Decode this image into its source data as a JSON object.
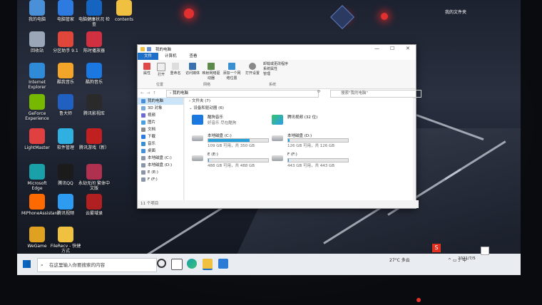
{
  "desktop_icons": [
    {
      "label": "我的电脑",
      "color": "#4a90d9"
    },
    {
      "label": "电脑管家",
      "color": "#2d7be0"
    },
    {
      "label": "电脑健康状况\n检查",
      "color": "#1565c0"
    },
    {
      "label": "contents",
      "color": "#f0c040"
    },
    {
      "label": "回收站",
      "color": "#9aa7b8"
    },
    {
      "label": "分区助手 9.1",
      "color": "#e0463a"
    },
    {
      "label": "陈时播放器",
      "color": "#d03040"
    },
    {
      "label": "Internet Explorer",
      "color": "#2f8ad8"
    },
    {
      "label": "酷我音乐",
      "color": "#f3a52a"
    },
    {
      "label": "酷狗音乐",
      "color": "#1b78e0"
    },
    {
      "label": "GeForce Experience",
      "color": "#76b900"
    },
    {
      "label": "鲁大师",
      "color": "#2060c0"
    },
    {
      "label": "腾讯影视库",
      "color": "#2a2a2a"
    },
    {
      "label": "LightMaster",
      "color": "#e04040"
    },
    {
      "label": "软件管理",
      "color": "#30b0e0"
    },
    {
      "label": "腾讯游戏（新）",
      "color": "#c02020"
    },
    {
      "label": "Microsoft Edge",
      "color": "#1aa0a8"
    },
    {
      "label": "腾讯QQ",
      "color": "#1b1b1b"
    },
    {
      "label": "永劫无间 繁体中文版",
      "color": "#b03050"
    },
    {
      "label": "MiPhoneAssistant",
      "color": "#ff6a00"
    },
    {
      "label": "腾讯视频",
      "color": "#2d9cf0"
    },
    {
      "label": "云雾域录",
      "color": "#b02020"
    },
    {
      "label": "WeGame",
      "color": "#e0a020"
    },
    {
      "label": "FileRecv - 快捷方式",
      "color": "#f0c040"
    }
  ],
  "top_right_label": "我的文件夹",
  "explorer": {
    "title": "我的电脑",
    "tabs": [
      "文件",
      "计算机",
      "查看"
    ],
    "ribbon": {
      "buttons": [
        "属性",
        "打开",
        "重命名",
        "访问媒体",
        "映射网络驱动器",
        "添加一个网络位置",
        "打开设置"
      ],
      "side_items": [
        "卸载或更改程序",
        "系统属性",
        "管理"
      ],
      "groups": [
        "位置",
        "网络",
        "系统"
      ]
    },
    "address": "我的电脑",
    "search_placeholder": "搜索\"我的电脑\"",
    "nav_items": [
      "我的电脑",
      "3D 对象",
      "视频",
      "图片",
      "文档",
      "下载",
      "音乐",
      "桌面",
      "本地磁盘 (C:)",
      "本地磁盘 (D:)",
      "E (E:)",
      "F (F:)"
    ],
    "section_folders": "文件夹 (7)",
    "section_devices": "设备和驱动器 (6)",
    "apps": [
      {
        "name": "酷狗音乐",
        "sub": "好音乐 尽在酷狗",
        "color": "#1b78e0"
      },
      {
        "name": "腾讯视频 (32 位)",
        "sub": "",
        "color": "#2d9cf0"
      }
    ],
    "drives": [
      {
        "name": "本地磁盘 (C:)",
        "space": "109 GB 可用，共 350 GB",
        "used": 0.69
      },
      {
        "name": "本地磁盘 (D:)",
        "space": "126 GB 可用，共 126 GB",
        "used": 0.02
      },
      {
        "name": "E (E:)",
        "space": "488 GB 可用，共 488 GB",
        "used": 0.01
      },
      {
        "name": "F (F:)",
        "space": "443 GB 可用，共 443 GB",
        "used": 0.01
      }
    ],
    "status": "11 个项目"
  },
  "taskbar": {
    "search_placeholder": "在这里输入你要搜索的内容",
    "weather": "27°C 多云",
    "time": "19:56",
    "date": "2021/7/5"
  }
}
